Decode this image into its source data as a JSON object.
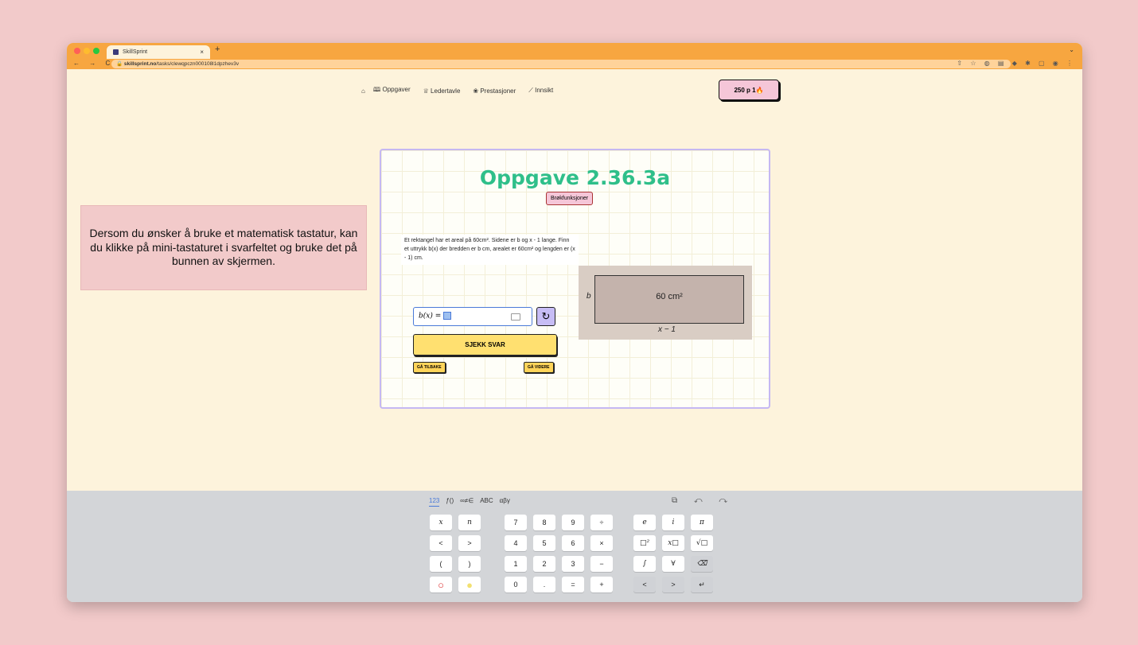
{
  "browser": {
    "tab_title": "SkillSprint",
    "tab_close": "×",
    "new_tab": "+",
    "nav_buttons": "← → C",
    "url_host": "skillsprint.no",
    "url_path": "/tasks/clewqpczn000108l1dpzhev3v",
    "chevron": "⌄",
    "extensions": "⇧ ☆ ◍ ▤ ◆ ✱ ▢ ◉ ⋮"
  },
  "nav": {
    "home_icon": "⌂",
    "tasks": "Oppgaver",
    "leaderboard": "Ledertavle",
    "achievements": "Prestasjoner",
    "insight": "Innsikt"
  },
  "points": "250 p  1🔥",
  "hint": "Dersom du ønsker å bruke et matematisk tastatur, kan du klikke på mini-tastaturet i svarfeltet og bruke det på bunnen av skjermen.",
  "task": {
    "title": "Oppgave 2.36.3a",
    "topic": "Brøkfunksjoner",
    "question": "Et rektangel har et areal på 60cm². Sidene er b og x - 1 lange. Finn et uttrykk b(x) der bredden er b cm, arealet er 60cm² og lengden er (x - 1) cm.",
    "answer_prefix": "b(x) =",
    "refresh": "↻",
    "check": "SJEKK SVAR",
    "back": "GÅ TILBAKE",
    "next": "GÅ VIDERE"
  },
  "figure": {
    "area": "60 cm²",
    "side_b": "b",
    "side_x": "x − 1"
  },
  "keyboard": {
    "tabs": [
      "123",
      "ƒ()",
      "∞≠∈",
      "ABC",
      "αβγ"
    ],
    "actions": "⧉ ↶ ↷",
    "rows": [
      [
        "x",
        "n",
        "7",
        "8",
        "9",
        "÷",
        "e",
        "i",
        "π"
      ],
      [
        "<",
        ">",
        "4",
        "5",
        "6",
        "×",
        "□²",
        "x□",
        "√□"
      ],
      [
        "(",
        ")",
        "1",
        "2",
        "3",
        "−",
        "∫",
        "∀",
        "⌫"
      ],
      [
        "○",
        "●",
        "0",
        ".",
        "=",
        "+",
        "<",
        ">",
        "↵"
      ]
    ]
  }
}
